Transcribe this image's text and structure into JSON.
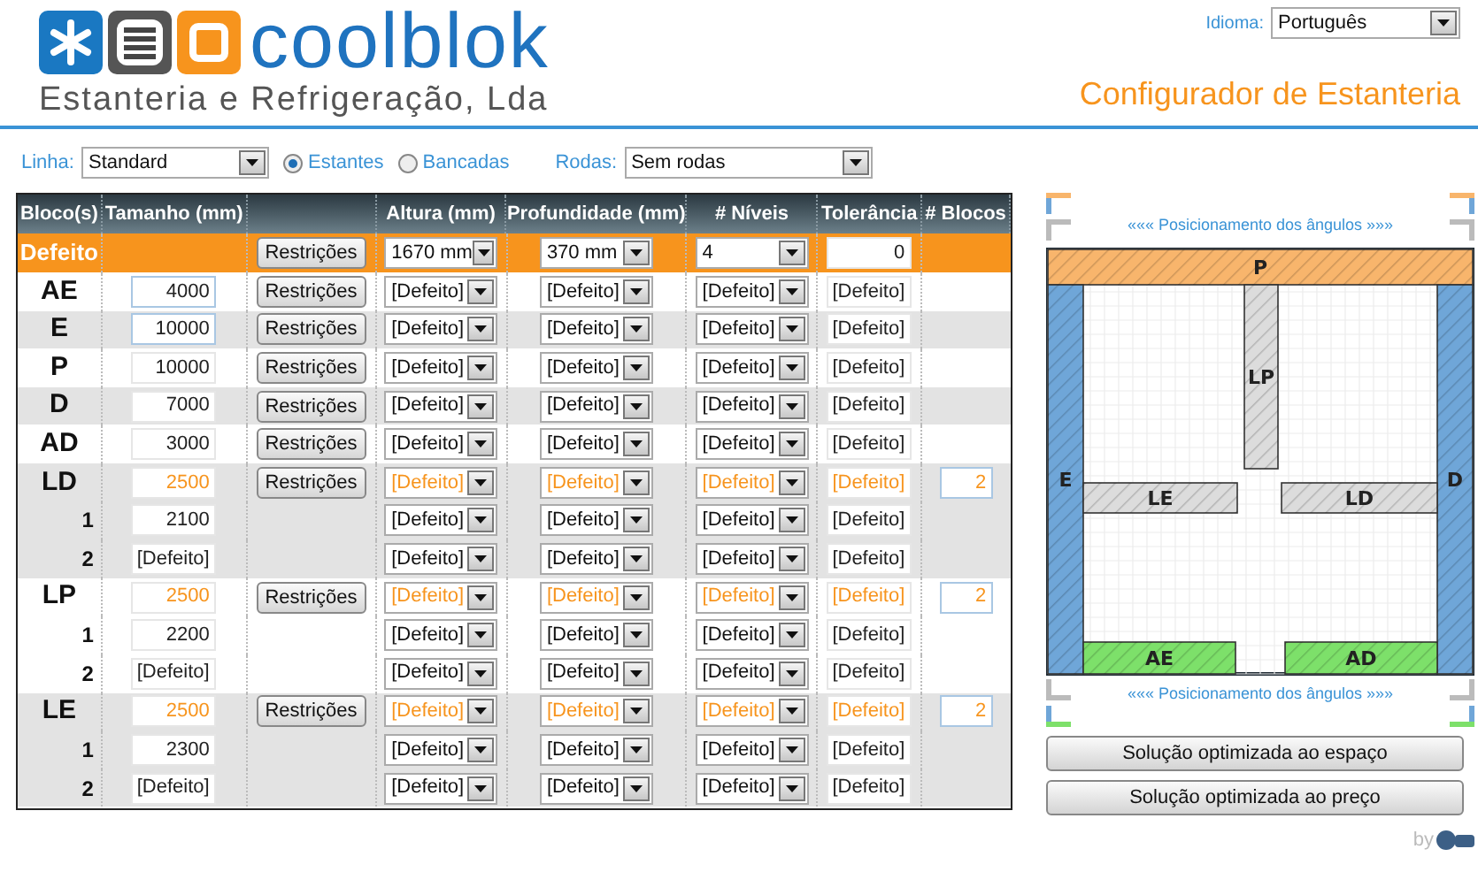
{
  "brand": {
    "name": "coolblok",
    "tagline": "Estanteria e Refrigeração, Lda"
  },
  "language": {
    "label": "Idioma:",
    "value": "Português"
  },
  "title": "Configurador de Estanteria",
  "filters": {
    "line": {
      "label": "Linha:",
      "value": "Standard"
    },
    "types": [
      {
        "label": "Estantes",
        "selected": true
      },
      {
        "label": "Bancadas",
        "selected": false
      }
    ],
    "wheels": {
      "label": "Rodas:",
      "value": "Sem rodas"
    }
  },
  "table": {
    "columns": [
      "Bloco(s)",
      "Tamanho (mm)",
      "Altura (mm)",
      "Profundidade (mm)",
      "# Níveis",
      "Tolerância",
      "# Blocos"
    ],
    "defaults": {
      "label": "Defeito",
      "button": "Restrições",
      "height": "1670 mm",
      "depth": "370 mm",
      "levels": "4",
      "tolerance": "0"
    },
    "rows": [
      {
        "kind": "main",
        "label": "AE",
        "size": "4000",
        "button": "Restrições",
        "height": "[Defeito]",
        "depth": "[Defeito]",
        "levels": "[Defeito]",
        "tolerance": "[Defeito]",
        "shaded": false,
        "highlighted": false
      },
      {
        "kind": "main",
        "label": "E",
        "size": "10000",
        "button": "Restrições",
        "height": "[Defeito]",
        "depth": "[Defeito]",
        "levels": "[Defeito]",
        "tolerance": "[Defeito]",
        "shaded": true,
        "highlighted": false
      },
      {
        "kind": "main",
        "label": "P",
        "size": "10000",
        "button": "Restrições",
        "height": "[Defeito]",
        "depth": "[Defeito]",
        "levels": "[Defeito]",
        "tolerance": "[Defeito]",
        "shaded": false,
        "highlighted": false
      },
      {
        "kind": "main",
        "label": "D",
        "size": "7000",
        "button": "Restrições",
        "height": "[Defeito]",
        "depth": "[Defeito]",
        "levels": "[Defeito]",
        "tolerance": "[Defeito]",
        "shaded": true,
        "highlighted": false
      },
      {
        "kind": "main",
        "label": "AD",
        "size": "3000",
        "button": "Restrições",
        "height": "[Defeito]",
        "depth": "[Defeito]",
        "levels": "[Defeito]",
        "tolerance": "[Defeito]",
        "shaded": false,
        "highlighted": false
      },
      {
        "kind": "main",
        "label": "LD",
        "size": "2500",
        "button": "Restrições",
        "height": "[Defeito]",
        "depth": "[Defeito]",
        "levels": "[Defeito]",
        "tolerance": "[Defeito]",
        "blocks": "2",
        "shaded": true,
        "highlighted": true
      },
      {
        "kind": "sub",
        "label": "1",
        "size": "2100",
        "height": "[Defeito]",
        "depth": "[Defeito]",
        "levels": "[Defeito]",
        "tolerance": "[Defeito]",
        "shaded": true,
        "highlighted": false
      },
      {
        "kind": "sub",
        "label": "2",
        "size": "[Defeito]",
        "height": "[Defeito]",
        "depth": "[Defeito]",
        "levels": "[Defeito]",
        "tolerance": "[Defeito]",
        "shaded": true,
        "highlighted": false
      },
      {
        "kind": "main",
        "label": "LP",
        "size": "2500",
        "button": "Restrições",
        "height": "[Defeito]",
        "depth": "[Defeito]",
        "levels": "[Defeito]",
        "tolerance": "[Defeito]",
        "blocks": "2",
        "shaded": false,
        "highlighted": true
      },
      {
        "kind": "sub",
        "label": "1",
        "size": "2200",
        "height": "[Defeito]",
        "depth": "[Defeito]",
        "levels": "[Defeito]",
        "tolerance": "[Defeito]",
        "shaded": false,
        "highlighted": false
      },
      {
        "kind": "sub",
        "label": "2",
        "size": "[Defeito]",
        "height": "[Defeito]",
        "depth": "[Defeito]",
        "levels": "[Defeito]",
        "tolerance": "[Defeito]",
        "shaded": false,
        "highlighted": false
      },
      {
        "kind": "main",
        "label": "LE",
        "size": "2500",
        "button": "Restrições",
        "height": "[Defeito]",
        "depth": "[Defeito]",
        "levels": "[Defeito]",
        "tolerance": "[Defeito]",
        "blocks": "2",
        "shaded": true,
        "highlighted": true
      },
      {
        "kind": "sub",
        "label": "1",
        "size": "2300",
        "height": "[Defeito]",
        "depth": "[Defeito]",
        "levels": "[Defeito]",
        "tolerance": "[Defeito]",
        "shaded": true,
        "highlighted": false
      },
      {
        "kind": "sub",
        "label": "2",
        "size": "[Defeito]",
        "height": "[Defeito]",
        "depth": "[Defeito]",
        "levels": "[Defeito]",
        "tolerance": "[Defeito]",
        "shaded": true,
        "highlighted": false
      }
    ]
  },
  "layout": {
    "top_link": "««« Posicionamento dos ângulos »»»",
    "bottom_link": "««« Posicionamento dos ângulos »»»",
    "blocks": [
      {
        "label": "P",
        "color": "#f8b56c"
      },
      {
        "label": "LP",
        "color": "#dcdcdc"
      },
      {
        "label": "E",
        "color": "#6fa6d8"
      },
      {
        "label": "D",
        "color": "#6fa6d8"
      },
      {
        "label": "LE",
        "color": "#dcdcdc"
      },
      {
        "label": "LD",
        "color": "#dcdcdc"
      },
      {
        "label": "AE",
        "color": "#7de06a"
      },
      {
        "label": "AD",
        "color": "#7de06a"
      }
    ]
  },
  "actions": [
    "Solução optimizada ao espaço",
    "Solução optimizada ao preço"
  ],
  "footer": {
    "by": "by"
  }
}
